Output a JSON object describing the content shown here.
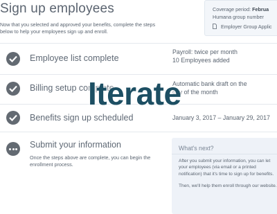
{
  "header": {
    "title": "Sign up employees",
    "intro": "Now that you selected and approved your benefits, complete the steps below to help your employees sign up and enroll."
  },
  "coverage": {
    "period_label": "Coverage period:",
    "period_value": "Februa",
    "group_number": "Humana group number",
    "agreement_link": "Employer Group Applic"
  },
  "steps": [
    {
      "label": "Employee list complete",
      "status": "complete",
      "details": [
        "Payroll: twice per month",
        "10 Employees added"
      ]
    },
    {
      "label": "Billing setup complete",
      "status": "complete",
      "details": [
        "Automatic bank draft on the",
        "day of the month"
      ]
    },
    {
      "label": "Benefits sign up scheduled",
      "status": "complete",
      "details": [
        "January 3, 2017 – January 29, 2017"
      ]
    },
    {
      "label": "Submit your information",
      "status": "pending",
      "description": "Once the steps above are complete, you can begin the enrollment process."
    }
  ],
  "whats_next": {
    "title": "What's next?",
    "paragraph1": "After you submit your information, you can let your employees (via email or a printed notification) that it's time to sign up for benefits.",
    "paragraph2": "Then, we'll help them enroll through our website."
  },
  "overlay": {
    "text": "Iterate",
    "color": "#1d4f63"
  },
  "colors": {
    "icon_fill": "#636a72",
    "divider": "#e4e8ed",
    "panel_bg": "#eef2f8"
  },
  "icons": {
    "complete": "check-circle-icon",
    "pending": "more-dots-icon",
    "document": "document-icon"
  }
}
